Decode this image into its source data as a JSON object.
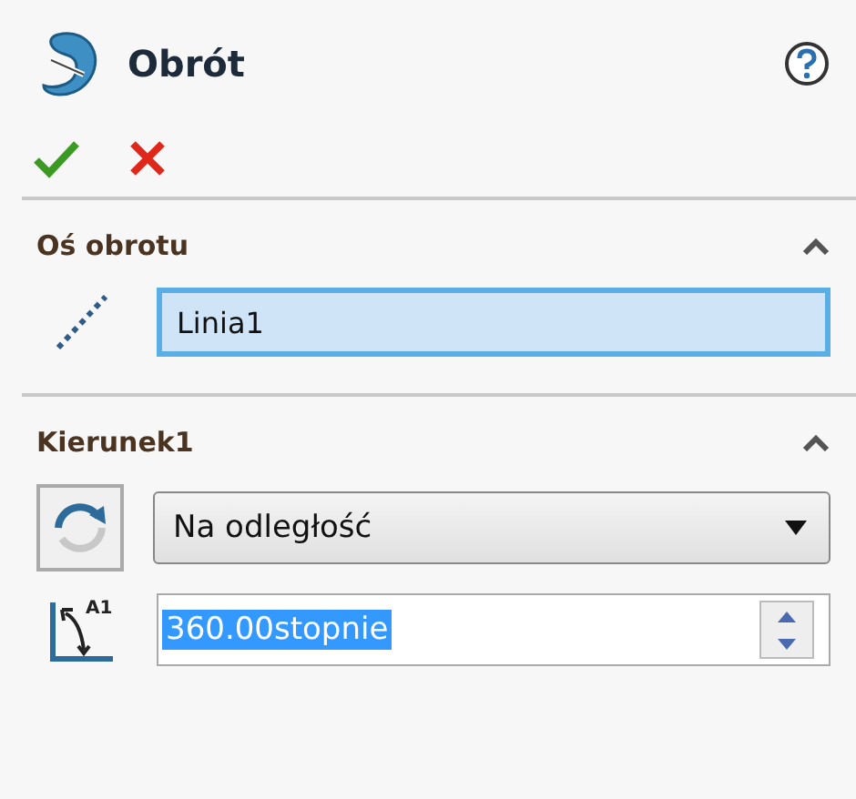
{
  "header": {
    "title": "Obrót"
  },
  "sections": [
    {
      "title": "Oś obrotu",
      "expanded": true,
      "rows": [
        {
          "kind": "selection",
          "value": "Linia1",
          "focused": true
        }
      ]
    },
    {
      "title": "Kierunek1",
      "expanded": true,
      "rows": [
        {
          "kind": "dropdown",
          "value": "Na odległość"
        },
        {
          "kind": "spin",
          "icon_label": "A1",
          "value": "360.00stopnie",
          "selected": true
        }
      ]
    }
  ]
}
